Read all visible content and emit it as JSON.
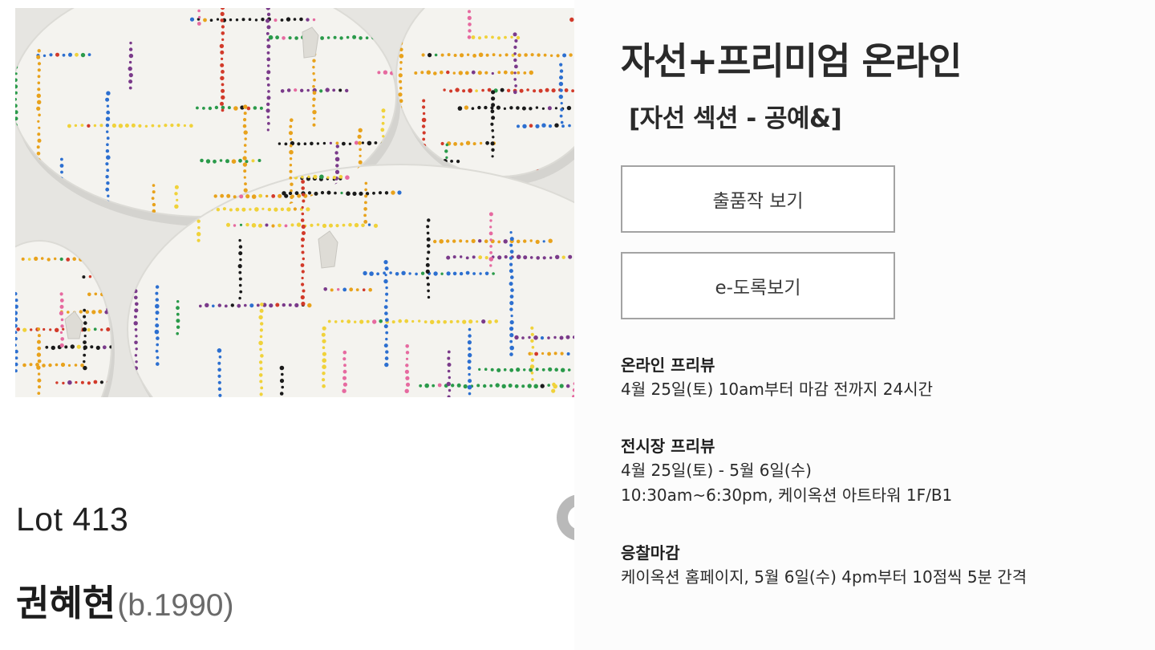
{
  "artwork": {
    "description_icon": "artwork-image",
    "palette": [
      "#d23a2a",
      "#e8a21c",
      "#2c6fd0",
      "#2a9a4a",
      "#7a3a8a",
      "#e66aa0",
      "#1a1a1a",
      "#f0d23a"
    ]
  },
  "lot": {
    "label": "Lot 413"
  },
  "artist": {
    "name": "권혜현",
    "years": "(b.1990)"
  },
  "auction": {
    "title": "자선+프리미엄 온라인",
    "subtitle": "[자선 섹션 - 공예&]"
  },
  "buttons": {
    "view_works": "출품작 보기",
    "view_catalog": "e-도록보기"
  },
  "schedule": {
    "online_preview": {
      "heading": "온라인 프리뷰",
      "line1": "4월 25일(토) 10am부터 마감 전까지 24시간"
    },
    "exhibition_preview": {
      "heading": "전시장 프리뷰",
      "line1": "4월 25일(토) - 5월 6일(수)",
      "line2": "10:30am~6:30pm, 케이옥션 아트타워 1F/B1"
    },
    "bid_close": {
      "heading": "응찰마감",
      "line1": "케이옥션 홈페이지, 5월 6일(수) 4pm부터 10점씩 5분 간격"
    }
  },
  "colors": {
    "button_border": "#a3a3a3",
    "text_dark": "#1e1e1e",
    "year_gray": "#6a6a6a"
  }
}
